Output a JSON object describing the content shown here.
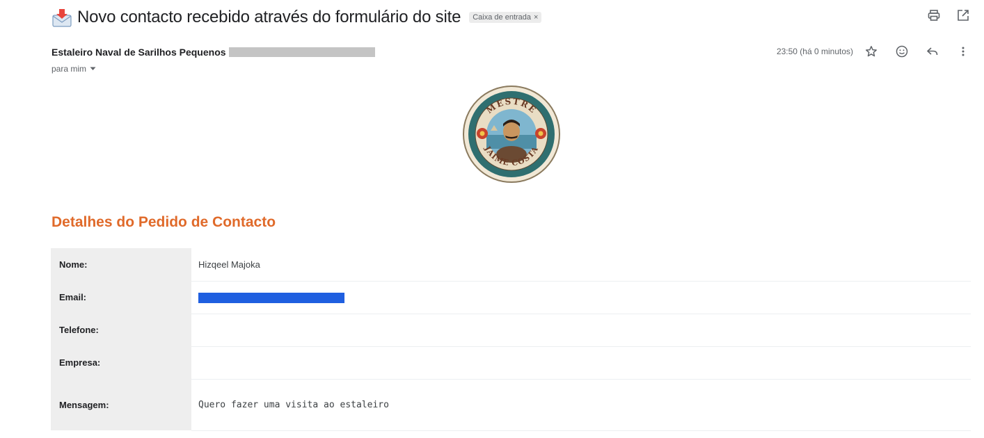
{
  "email": {
    "subject": "Novo contacto recebido através do formulário do site",
    "label": "Caixa de entrada",
    "label_close": "×",
    "sender_name": "Estaleiro Naval de Sarilhos Pequenos",
    "recipient": "para mim",
    "timestamp": "23:50 (há 0 minutos)"
  },
  "logo": {
    "top_text": "MESTRE",
    "bottom_text": "JAIME COSTA"
  },
  "details": {
    "title": "Detalhes do Pedido de Contacto",
    "rows": [
      {
        "label": "Nome:",
        "value": "Hizqeel Majoka"
      },
      {
        "label": "Email:",
        "value": ""
      },
      {
        "label": "Telefone:",
        "value": ""
      },
      {
        "label": "Empresa:",
        "value": ""
      },
      {
        "label": "Mensagem:",
        "value": "Quero fazer uma visita ao estaleiro"
      }
    ]
  },
  "icons": {
    "subject_icon": "incoming-envelope-icon",
    "print": "print-icon",
    "open_new_window": "open-in-new-window-icon",
    "star": "star-icon",
    "emoji": "emoji-reaction-icon",
    "reply": "reply-icon",
    "more": "more-vert-icon",
    "recipient_dropdown": "chevron-down-icon"
  },
  "colors": {
    "accent_title": "#e06a2a",
    "redaction_blue": "#1f5fe0",
    "redaction_gray": "#c4c4c4",
    "key_cell_bg": "#eeeeee"
  }
}
